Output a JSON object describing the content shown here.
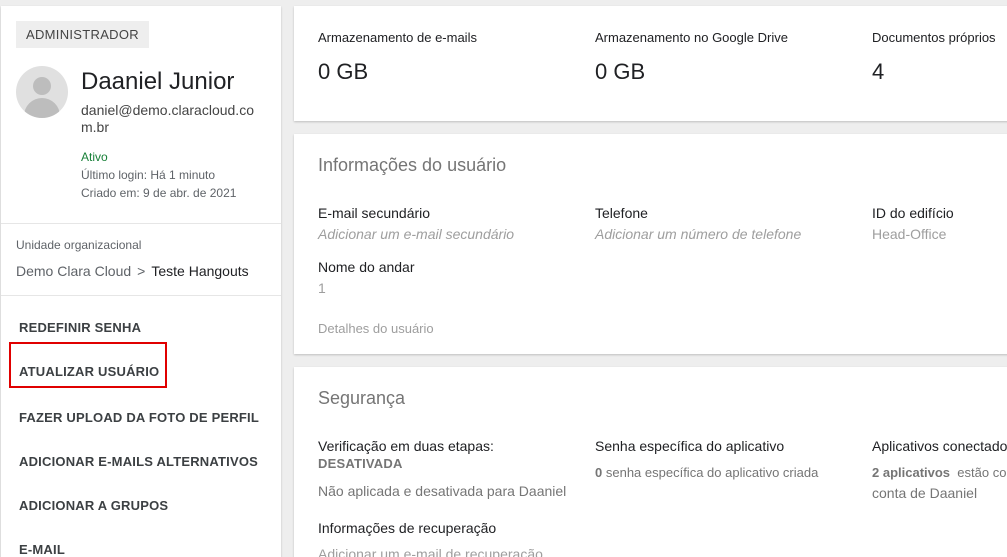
{
  "profile": {
    "role": "ADMINISTRADOR",
    "name": "Daaniel Junior",
    "email": "daniel@demo.claracloud.com.br",
    "status": "Ativo",
    "last_login": "Último login: Há 1 minuto",
    "created": "Criado em: 9 de abr. de 2021"
  },
  "org_unit": {
    "label": "Unidade organizacional",
    "parent": "Demo Clara Cloud",
    "separator": ">",
    "current": "Teste Hangouts"
  },
  "actions": {
    "reset_password": "REDEFINIR SENHA",
    "update_user": "ATUALIZAR USUÁRIO",
    "upload_photo": "FAZER UPLOAD DA FOTO DE PERFIL",
    "add_alt_emails": "ADICIONAR E-MAILS ALTERNATIVOS",
    "add_to_groups": "ADICIONAR A GRUPOS",
    "email": "E-MAIL"
  },
  "storage": {
    "email_label": "Armazenamento de e-mails",
    "email_value": "0 GB",
    "drive_label": "Armazenamento no Google Drive",
    "drive_value": "0 GB",
    "docs_label": "Documentos próprios",
    "docs_value": "4"
  },
  "user_info": {
    "title": "Informações do usuário",
    "secondary_email_label": "E-mail secundário",
    "secondary_email_value": "Adicionar um e-mail secundário",
    "phone_label": "Telefone",
    "phone_value": "Adicionar um número de telefone",
    "building_label": "ID do edifício",
    "building_value": "Head-Office",
    "floor_label": "Nome do andar",
    "floor_value": "1",
    "details_link": "Detalhes do usuário"
  },
  "security": {
    "title": "Segurança",
    "two_step_label": "Verificação em duas etapas:",
    "two_step_state": "DESATIVADA",
    "two_step_desc": "Não aplicada e desativada para Daaniel",
    "app_password_label": "Senha específica do aplicativo",
    "app_password_count": "0",
    "app_password_desc": "senha específica do aplicativo criada",
    "connected_apps_label": "Aplicativos conectado",
    "connected_apps_count": "2 aplicativos",
    "connected_apps_desc": "estão co",
    "connected_apps_desc2": "conta de Daaniel",
    "recovery_label": "Informações de recuperação",
    "recovery_value": "Adicionar um e-mail de recuperação"
  }
}
